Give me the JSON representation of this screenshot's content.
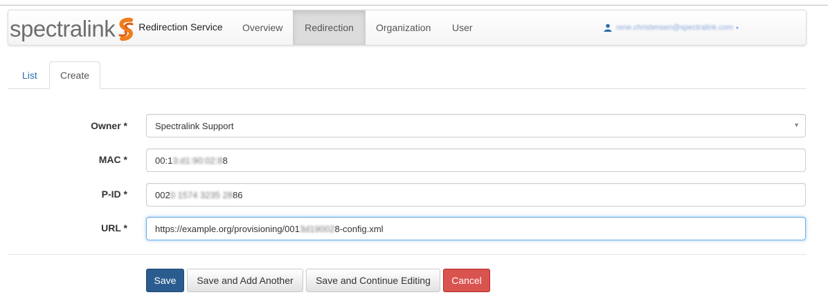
{
  "brand": {
    "word": "spectralink",
    "service": "Redirection Service"
  },
  "nav": {
    "items": [
      {
        "label": "Overview"
      },
      {
        "label": "Redirection"
      },
      {
        "label": "Organization"
      },
      {
        "label": "User"
      }
    ],
    "active": "Redirection",
    "user_email": "rene.christensen@spectralink.com",
    "user_caret": "▾"
  },
  "tabs": [
    {
      "label": "List"
    },
    {
      "label": "Create"
    }
  ],
  "form": {
    "owner": {
      "label": "Owner *",
      "value": "Spectralink Support"
    },
    "mac": {
      "label": "MAC *",
      "value_visible_start": "00:1",
      "value_blurred": "3:d1:90:02:8",
      "value_visible_end": "8"
    },
    "pid": {
      "label": "P-ID *",
      "value_visible_start": "002",
      "value_blurred": "0 1574 3235 28",
      "value_visible_end": "86"
    },
    "url": {
      "label": "URL *",
      "value_visible_start": "https://example.org/provisioning/001",
      "value_blurred": "3d19002",
      "value_visible_end": "8-config.xml"
    }
  },
  "buttons": {
    "save": "Save",
    "save_add": "Save and Add Another",
    "save_continue": "Save and Continue Editing",
    "cancel": "Cancel"
  },
  "colors": {
    "brand_orange": "#f07d1d",
    "primary": "#2b5c8f",
    "danger": "#d9534f",
    "link": "#2a6db0"
  }
}
